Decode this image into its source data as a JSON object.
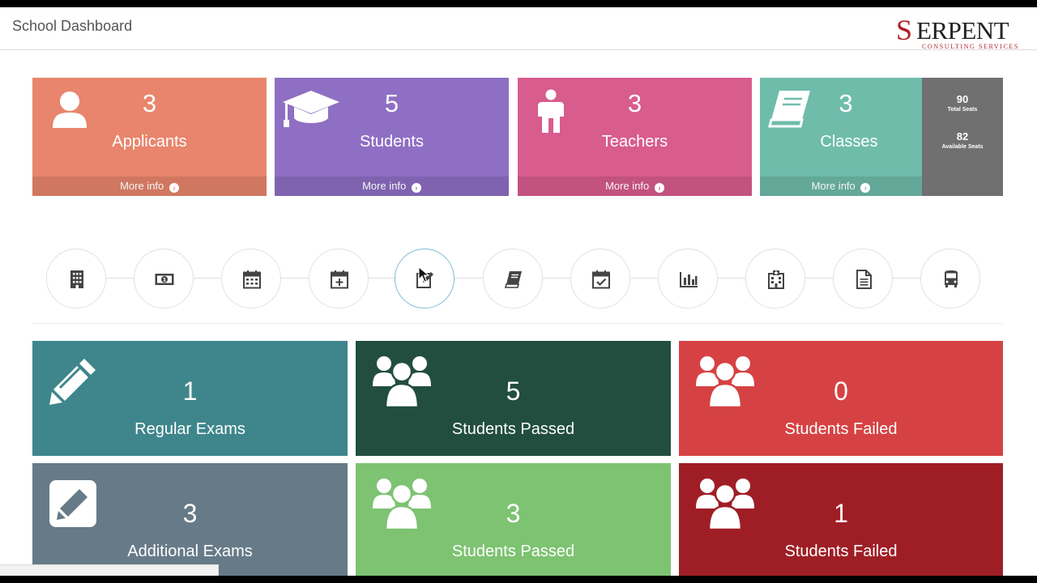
{
  "header": {
    "title": "School Dashboard"
  },
  "logo": {
    "initial": "S",
    "word": "ERPENT",
    "tagline": "CONSULTING SERVICES"
  },
  "top_cards": [
    {
      "count": "3",
      "label": "Applicants",
      "more": "More info",
      "color": "#e8856c",
      "icon": "user-icon"
    },
    {
      "count": "5",
      "label": "Students",
      "more": "More info",
      "color": "#8e6fc4",
      "icon": "graduation-cap-icon"
    },
    {
      "count": "3",
      "label": "Teachers",
      "more": "More info",
      "color": "#d85c8e",
      "icon": "male-person-icon"
    },
    {
      "count": "3",
      "label": "Classes",
      "more": "More info",
      "color": "#6fbcab",
      "icon": "book-icon"
    }
  ],
  "seats": {
    "total": "90",
    "total_label": "Total Seats",
    "available": "82",
    "available_label": "Available Seats"
  },
  "steps": [
    {
      "icon": "building-icon"
    },
    {
      "icon": "money-icon"
    },
    {
      "icon": "calendar-icon"
    },
    {
      "icon": "calendar-plus-icon"
    },
    {
      "icon": "edit-icon",
      "active": true
    },
    {
      "icon": "book-icon"
    },
    {
      "icon": "calendar-check-icon"
    },
    {
      "icon": "bar-chart-icon"
    },
    {
      "icon": "hospital-icon"
    },
    {
      "icon": "document-icon"
    },
    {
      "icon": "bus-icon"
    }
  ],
  "exam_cards": [
    {
      "count": "1",
      "label": "Regular Exams",
      "color": "#3e868b",
      "icon": "pencil-icon"
    },
    {
      "count": "5",
      "label": "Students Passed",
      "color": "#224e40",
      "icon": "users-icon"
    },
    {
      "count": "0",
      "label": "Students Failed",
      "color": "#d64243",
      "icon": "users-icon"
    },
    {
      "count": "3",
      "label": "Additional Exams",
      "color": "#667a87",
      "icon": "pencil-square-icon"
    },
    {
      "count": "3",
      "label": "Students Passed",
      "color": "#7dc372",
      "icon": "users-icon"
    },
    {
      "count": "1",
      "label": "Students Failed",
      "color": "#9f1e26",
      "icon": "users-icon"
    }
  ]
}
